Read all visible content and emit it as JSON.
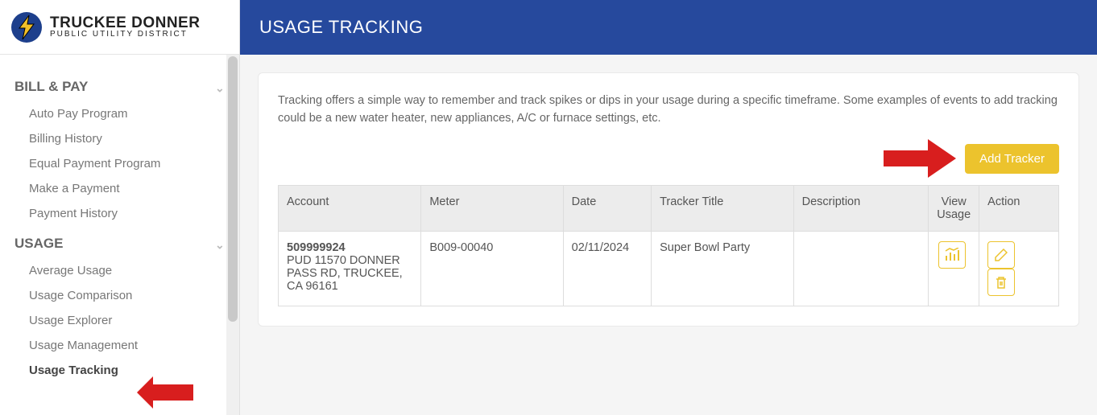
{
  "logo": {
    "main": "TRUCKEE DONNER",
    "sub": "PUBLIC UTILITY DISTRICT"
  },
  "sidebar": {
    "groups": [
      {
        "label": "BILL & PAY",
        "items": [
          {
            "label": "Auto Pay Program"
          },
          {
            "label": "Billing History"
          },
          {
            "label": "Equal Payment Program"
          },
          {
            "label": "Make a Payment"
          },
          {
            "label": "Payment History"
          }
        ]
      },
      {
        "label": "USAGE",
        "items": [
          {
            "label": "Average Usage"
          },
          {
            "label": "Usage Comparison"
          },
          {
            "label": "Usage Explorer"
          },
          {
            "label": "Usage Management"
          },
          {
            "label": "Usage Tracking",
            "active": true
          }
        ]
      }
    ]
  },
  "page": {
    "title": "USAGE TRACKING",
    "intro": "Tracking offers a simple way to remember and track spikes or dips in your usage during a specific timeframe. Some examples of events to add tracking could be a new water heater, new appliances, A/C or furnace settings, etc.",
    "add_button": "Add Tracker"
  },
  "table": {
    "headers": {
      "account": "Account",
      "meter": "Meter",
      "date": "Date",
      "tracker": "Tracker Title",
      "desc": "Description",
      "view": "View Usage",
      "action": "Action"
    },
    "rows": [
      {
        "account_number": "509999924",
        "account_address": "PUD 11570 DONNER PASS RD, TRUCKEE, CA 96161",
        "meter": "B009-00040",
        "date": "02/11/2024",
        "tracker": "Super Bowl Party",
        "desc": ""
      }
    ]
  }
}
